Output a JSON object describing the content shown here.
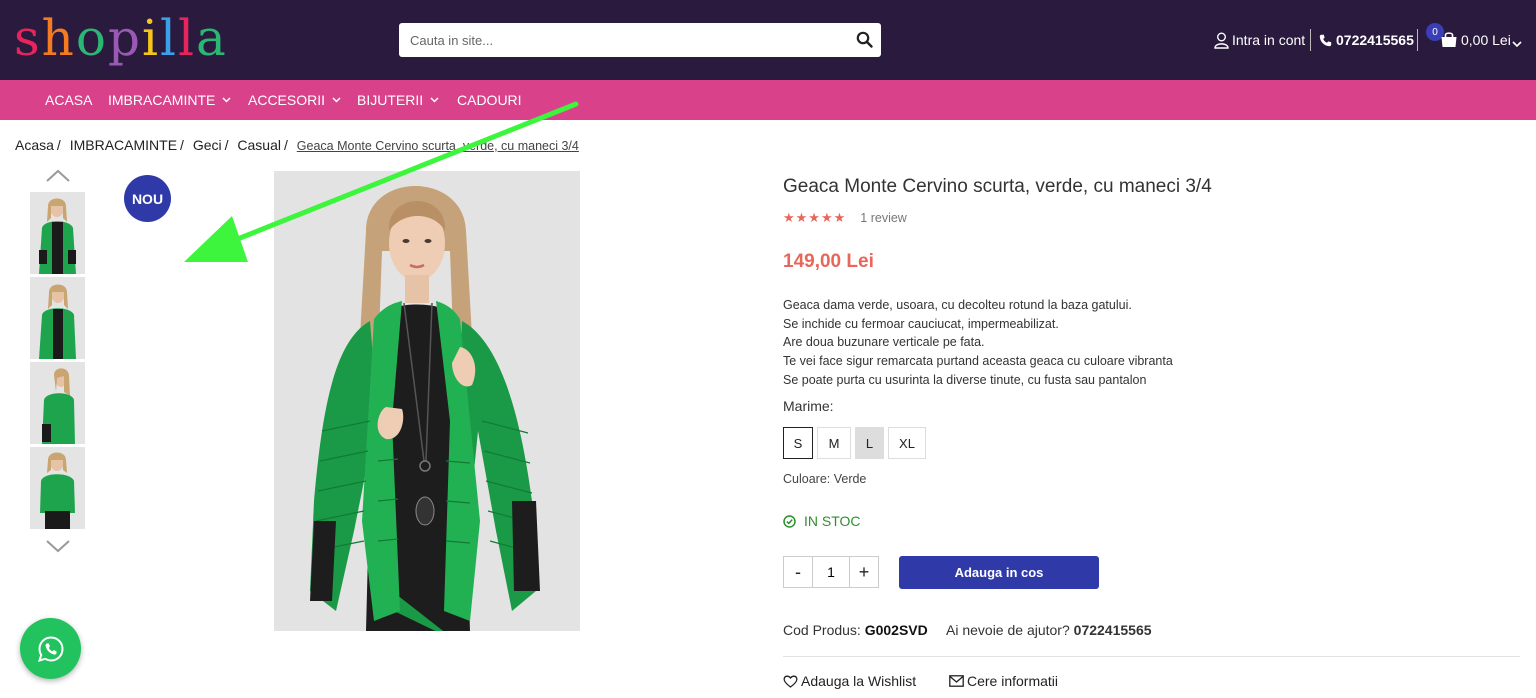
{
  "header": {
    "logo_text": "shopilla",
    "logo_colors": [
      "#e8245c",
      "#f47b20",
      "#2bb673",
      "#9b59b6",
      "#f5c518",
      "#3aa0e8",
      "#e8245c",
      "#2bb673"
    ],
    "search_placeholder": "Cauta in site...",
    "account_label": "Intra in cont",
    "phone": "0722415565",
    "cart_count": "0",
    "cart_total": "0,00 Lei"
  },
  "nav": {
    "items": [
      {
        "label": "ACASA",
        "dropdown": false
      },
      {
        "label": "IMBRACAMINTE",
        "dropdown": true
      },
      {
        "label": "ACCESORII",
        "dropdown": true
      },
      {
        "label": "BIJUTERII",
        "dropdown": true
      },
      {
        "label": "CADOURI",
        "dropdown": false
      }
    ]
  },
  "breadcrumb": {
    "items": [
      "Acasa",
      "IMBRACAMINTE",
      "Geci",
      "Casual"
    ],
    "current": "Geaca Monte Cervino scurta, verde, cu maneci 3/4"
  },
  "gallery": {
    "badge": "NOU",
    "thumbnail_count": 4
  },
  "product": {
    "title": "Geaca Monte Cervino scurta, verde, cu maneci 3/4",
    "stars": "★★★★★",
    "rating": 5,
    "review_count": "1 review",
    "price": "149,00 Lei",
    "description": [
      "Geaca dama verde, usoara, cu decolteu rotund la baza gatului.",
      "Se inchide cu fermoar cauciucat, impermeabilizat.",
      "Are doua buzunare verticale pe fata.",
      "Te vei face sigur remarcata purtand aceasta geaca cu culoare vibranta",
      "Se poate purta cu usurinta la diverse tinute, cu fusta sau pantalon"
    ],
    "size_label": "Marime:",
    "sizes": [
      "S",
      "M",
      "L",
      "XL"
    ],
    "selected_size": "S",
    "unavailable_size": "L",
    "color_label": "Culoare: Verde",
    "stock": "IN STOC",
    "quantity": "1",
    "qty_minus": "-",
    "qty_plus": "+",
    "add_to_cart": "Adauga in cos",
    "code_label": "Cod Produs:",
    "code_value": "G002SVD",
    "help_label": "Ai nevoie de ajutor?",
    "help_phone": "0722415565",
    "wishlist": "Adauga la Wishlist",
    "info_request": "Cere informatii"
  },
  "colors": {
    "header_bg": "#2a1a3e",
    "nav_bg": "#d9418b",
    "accent_blue": "#2f3aa8",
    "price_color": "#e8665a",
    "stock_green": "#2f8f2f",
    "whatsapp_green": "#22c35e",
    "annotation_arrow": "#3cf53c"
  }
}
